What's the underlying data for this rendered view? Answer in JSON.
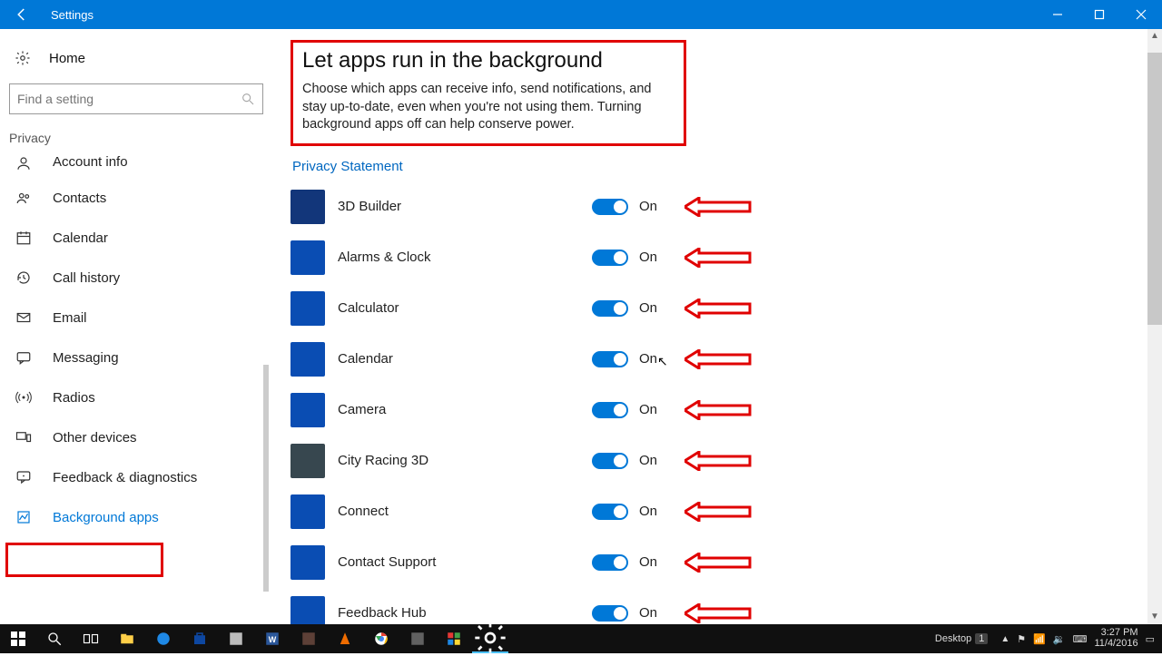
{
  "window": {
    "title": "Settings"
  },
  "sidebar": {
    "home": "Home",
    "search_placeholder": "Find a setting",
    "category": "Privacy",
    "items": [
      {
        "label": "Account info",
        "icon": "person",
        "cut": true
      },
      {
        "label": "Contacts",
        "icon": "contacts"
      },
      {
        "label": "Calendar",
        "icon": "calendar"
      },
      {
        "label": "Call history",
        "icon": "history"
      },
      {
        "label": "Email",
        "icon": "mail"
      },
      {
        "label": "Messaging",
        "icon": "chat"
      },
      {
        "label": "Radios",
        "icon": "radio"
      },
      {
        "label": "Other devices",
        "icon": "devices"
      },
      {
        "label": "Feedback & diagnostics",
        "icon": "feedback"
      },
      {
        "label": "Background apps",
        "icon": "bgapps",
        "selected": true
      }
    ]
  },
  "main": {
    "title": "Let apps run in the background",
    "description": "Choose which apps can receive info, send notifications, and stay up-to-date, even when you're not using them. Turning background apps off can help conserve power.",
    "privacy_link": "Privacy Statement",
    "toggle_on": "On",
    "apps": [
      {
        "name": "3D Builder",
        "on": true
      },
      {
        "name": "Alarms & Clock",
        "on": true
      },
      {
        "name": "Calculator",
        "on": true
      },
      {
        "name": "Calendar",
        "on": true
      },
      {
        "name": "Camera",
        "on": true
      },
      {
        "name": "City Racing 3D",
        "on": true
      },
      {
        "name": "Connect",
        "on": true
      },
      {
        "name": "Contact Support",
        "on": true
      },
      {
        "name": "Feedback Hub",
        "on": true
      }
    ]
  },
  "taskbar": {
    "desktop_label": "Desktop",
    "desktop_num": "1",
    "time": "3:27 PM",
    "date": "11/4/2016"
  },
  "annotations": {
    "highlight_color": "#e00000"
  }
}
